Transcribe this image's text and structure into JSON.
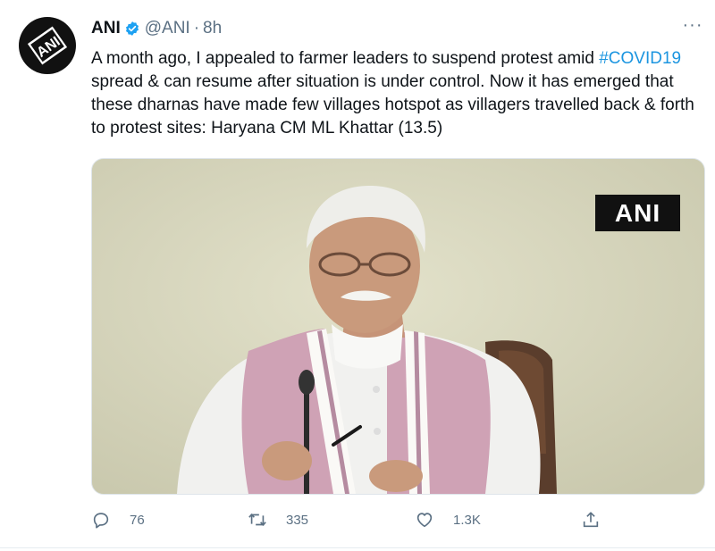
{
  "tweet": {
    "author": {
      "display_name": "ANI",
      "handle": "@ANI",
      "separator": "·",
      "time": "8h",
      "verified": true,
      "avatar_text": "ANI"
    },
    "text_before": "A month ago, I appealed to farmer leaders to suspend protest amid ",
    "hashtag": "#COVID19",
    "text_after": " spread & can resume after situation is under control. Now it has emerged that these dharnas have made few villages hotspot as villagers travelled back & forth to protest sites: Haryana CM ML Khattar (13.5)",
    "media": {
      "watermark": "ANI"
    },
    "actions": {
      "replies": "76",
      "retweets": "335",
      "likes": "1.3K"
    },
    "more_menu": "···"
  },
  "colors": {
    "link": "#1b95e0",
    "secondary_text": "#5b7083",
    "verified": "#1da1f2",
    "text": "#0f1419"
  },
  "icons": [
    "verified-badge-icon",
    "more-icon",
    "reply-icon",
    "retweet-icon",
    "like-icon",
    "share-icon"
  ]
}
